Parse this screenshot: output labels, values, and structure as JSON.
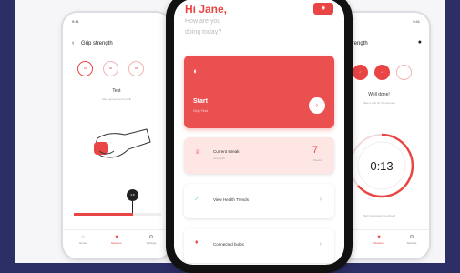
{
  "left": {
    "status_time": "9:41",
    "title": "Grip strength",
    "tabs": [
      "01",
      "02",
      "03"
    ],
    "test_label": "Test",
    "test_desc": "Start squeezing the bulb",
    "gauge_value": "4.8",
    "nav": [
      "Home",
      "Measure",
      "Settings"
    ]
  },
  "center": {
    "greeting": "Hi Jane,",
    "question_line1": "How are you",
    "question_line2": "doing today?",
    "start_label": "Start",
    "start_sub": "Grip Test",
    "streak_label": "Current streak",
    "streak_sub": "Great job!",
    "streak_value": "7",
    "streak_unit": "Weeks",
    "trends_label": "View Health Trends",
    "connected_label": "Connected bulbs"
  },
  "right": {
    "status_time": "9:41",
    "title": "Grip strength",
    "done_title": "Well done!",
    "done_desc": "Take a rest for 30 seconds",
    "timer": "0:13",
    "footer_text": "Well Concluded. Go Ahead",
    "nav": [
      "Home",
      "Measure",
      "Settings"
    ]
  },
  "colors": {
    "accent": "#e94545",
    "frame": "#2c2f66"
  }
}
